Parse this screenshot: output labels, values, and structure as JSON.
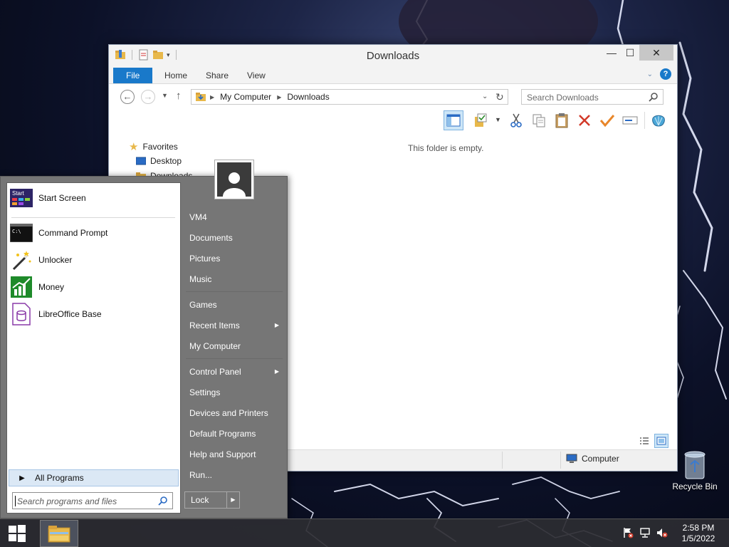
{
  "window": {
    "title": "Downloads",
    "ribbon_tabs": {
      "file": "File",
      "home": "Home",
      "share": "Share",
      "view": "View"
    },
    "breadcrumb": [
      "My Computer",
      "Downloads"
    ],
    "search_placeholder": "Search Downloads",
    "nav_items": {
      "favorites": "Favorites",
      "desktop": "Desktop",
      "downloads": "Downloads"
    },
    "empty_message": "This folder is empty.",
    "status_location": "Computer"
  },
  "start_menu": {
    "pinned": [
      {
        "label": "Start Screen",
        "icon": "start-screen-icon"
      },
      {
        "label": "Command Prompt",
        "icon": "command-prompt-icon"
      },
      {
        "label": "Unlocker",
        "icon": "magic-wand-icon"
      },
      {
        "label": "Money",
        "icon": "money-chart-icon"
      },
      {
        "label": "LibreOffice Base",
        "icon": "database-icon"
      }
    ],
    "start_icon_text": "Start",
    "all_programs": "All Programs",
    "search_placeholder": "Search programs and files",
    "right_links": {
      "user": "VM4",
      "documents": "Documents",
      "pictures": "Pictures",
      "music": "Music",
      "games": "Games",
      "recent_items": "Recent Items",
      "my_computer": "My Computer",
      "control_panel": "Control Panel",
      "settings": "Settings",
      "devices_printers": "Devices and Printers",
      "default_programs": "Default Programs",
      "help_support": "Help and Support",
      "run": "Run..."
    },
    "lock_label": "Lock"
  },
  "desktop": {
    "recycle_bin": "Recycle Bin"
  },
  "taskbar": {
    "time": "2:58 PM",
    "date": "1/5/2022"
  }
}
